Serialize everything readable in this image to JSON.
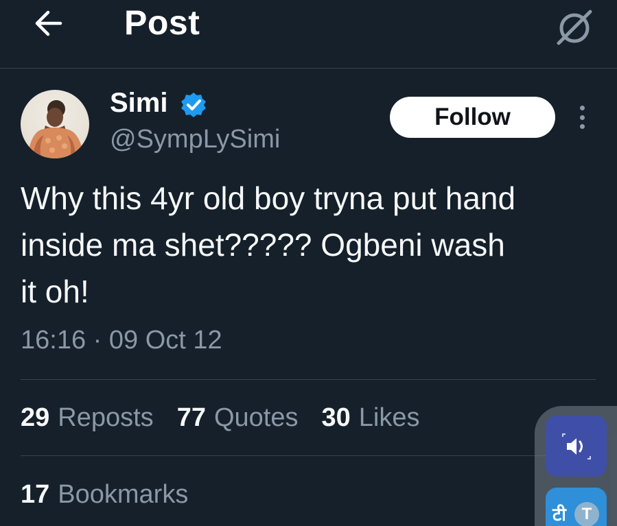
{
  "header": {
    "title": "Post",
    "back_icon": "arrow-left-icon",
    "right_icon": "grok-icon"
  },
  "author": {
    "name": "Simi",
    "handle": "@SympLySimi",
    "verified": true,
    "verified_color": "#1d9bf0",
    "follow_label": "Follow",
    "more_icon": "more-vertical-icon"
  },
  "tweet": {
    "text": "Why this 4yr old boy tryna put hand\ninside ma shet????? Ogbeni wash\nit oh!",
    "timestamp": "16:16 · 09 Oct 12"
  },
  "stats": {
    "reposts": {
      "count": "29",
      "label": "Reposts"
    },
    "quotes": {
      "count": "77",
      "label": "Quotes"
    },
    "likes": {
      "count": "30",
      "label": "Likes"
    },
    "bookmarks": {
      "count": "17",
      "label": "Bookmarks"
    }
  },
  "floating_tools": {
    "audio_icon": "speaker-icon",
    "translate_glyph": "टी",
    "translate_letter": "T"
  },
  "colors": {
    "background": "#15202b",
    "secondary_text": "#8b98a5",
    "divider": "#38444d",
    "accent": "#1d9bf0"
  }
}
